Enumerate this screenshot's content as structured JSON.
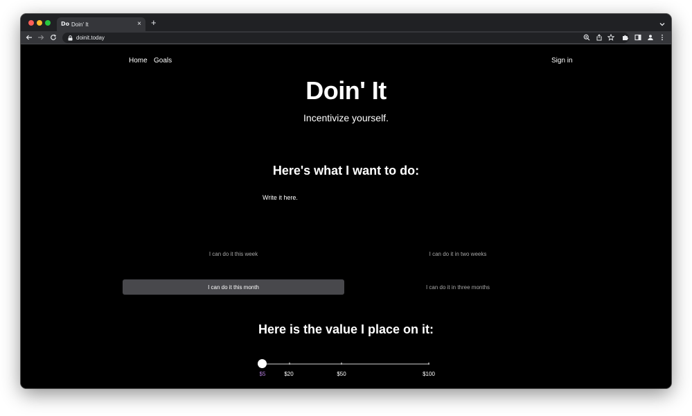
{
  "browser": {
    "tab_title": "Doin' It",
    "tab_favicon": "Do",
    "new_tab": "+",
    "url": "doinit.today"
  },
  "nav": {
    "home": "Home",
    "goals": "Goals",
    "sign_in": "Sign in"
  },
  "hero": {
    "title": "Doin' It",
    "subtitle": "Incentivize yourself."
  },
  "goal_section": {
    "heading": "Here's what I want to do:",
    "input_placeholder": "Write it here.",
    "timeframes": [
      {
        "label": "I can do it this week",
        "selected": false
      },
      {
        "label": "I can do it in two weeks",
        "selected": false
      },
      {
        "label": "I can do it this month",
        "selected": true
      },
      {
        "label": "I can do it in three months",
        "selected": false
      }
    ]
  },
  "value_section": {
    "heading": "Here is the value I place on it:",
    "slider": {
      "min": 5,
      "max": 100,
      "value": 5,
      "labels": [
        "$5",
        "$20",
        "$50",
        "$100"
      ]
    }
  },
  "colors": {
    "page_bg": "#000000",
    "selected_option_bg": "#48484c",
    "slider_active_label": "#b07ad8"
  },
  "icons": {
    "back": "arrow-left-icon",
    "forward": "arrow-right-icon",
    "reload": "reload-icon",
    "lock": "lock-icon",
    "zoom": "zoom-icon",
    "share": "share-icon",
    "bookmark": "star-icon",
    "extensions": "puzzle-icon",
    "sidebar": "sidebar-icon",
    "profile": "profile-icon",
    "menu": "kebab-menu-icon"
  }
}
